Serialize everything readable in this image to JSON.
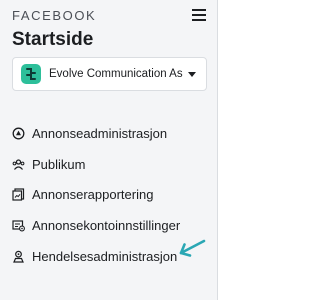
{
  "header": {
    "brand": "FACEBOOK",
    "page_title": "Startside"
  },
  "account": {
    "name": "Evolve Communication As"
  },
  "nav": {
    "items": [
      {
        "label": "Annonseadministrasjon",
        "icon": "circle-arrow-icon"
      },
      {
        "label": "Publikum",
        "icon": "audience-icon"
      },
      {
        "label": "Annonserapportering",
        "icon": "report-icon"
      },
      {
        "label": "Annonsekontoinnstillinger",
        "icon": "account-settings-icon"
      },
      {
        "label": "Hendelsesadministrasjon",
        "icon": "events-icon"
      }
    ]
  },
  "annotation": {
    "arrow_color": "#2aa7b4"
  },
  "colors": {
    "sidebar_bg": "#f4f5f7",
    "text": "#1c1e21",
    "logo": "#2dbf9a"
  }
}
